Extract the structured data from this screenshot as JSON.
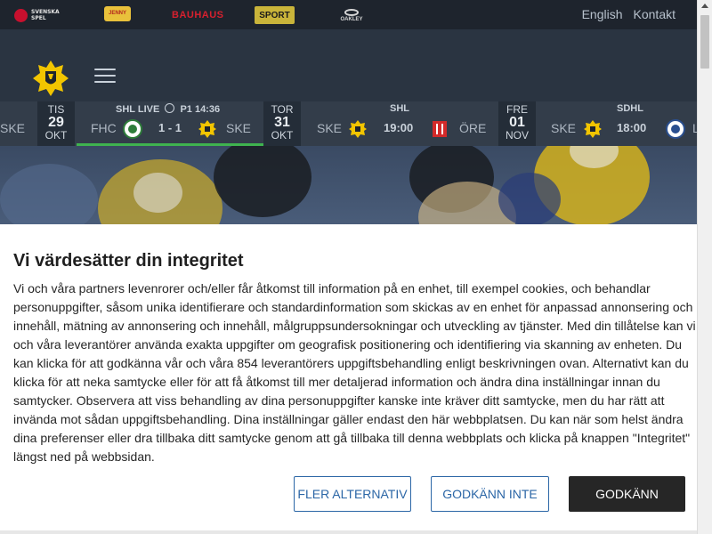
{
  "sponsors": {
    "svenska_spel": "SVENSKA SPEL",
    "jenny": "JENNY",
    "bauhaus": "BAUHAUS",
    "sport": "SPORT",
    "oakley": "OAKLEY"
  },
  "top_links": {
    "english": "English",
    "contact": "Kontakt"
  },
  "games": {
    "g0": {
      "team": "SKE"
    },
    "d1": {
      "dow": "TIS",
      "day": "29",
      "mon": "OKT"
    },
    "g1": {
      "head_league": "SHL LIVE",
      "head_period": "P1 14:36",
      "home": "FHC",
      "score": "1 - 1",
      "away": "SKE"
    },
    "d2": {
      "dow": "TOR",
      "day": "31",
      "mon": "OKT"
    },
    "g2": {
      "head": "SHL",
      "home": "SKE",
      "time": "19:00",
      "away": "ÖRE"
    },
    "d3": {
      "dow": "FRE",
      "day": "01",
      "mon": "NOV"
    },
    "g3": {
      "head": "SDHL",
      "home": "SKE",
      "time": "18:00",
      "away": "L"
    }
  },
  "consent": {
    "title": "Vi värdesätter din integritet",
    "body": "Vi och våra partners levenrorer och/eller får åtkomst till information på en enhet, till exempel cookies, och behandlar personuppgifter, såsom unika identifierare och standardinformation som skickas av en enhet för anpassad annonsering och innehåll, mätning av annonsering och innehåll, målgruppsundersokningar och utveckling av tjänster. Med din tillåtelse kan vi och våra leverantörer använda exakta uppgifter om geografisk positionering och identifiering via skanning av enheten. Du kan klicka för att godkänna vår och våra 854 leverantörers uppgiftsbehandling enligt beskrivningen ovan. Alternativt kan du klicka för att neka samtycke eller för att få åtkomst till mer detaljerad information och ändra dina inställningar innan du samtycker. Observera att viss behandling av dina personuppgifter kanske inte kräver ditt samtycke, men du har rätt att invända mot sådan uppgiftsbehandling. Dina inställningar gäller endast den här webbplatsen. Du kan när som helst ändra dina preferenser eller dra tillbaka ditt samtycke genom att gå tillbaka till denna webbplats och klicka på knappen \"Integritet\" längst ned på webbsidan.",
    "btn_more": "FLER ALTERNATIV",
    "btn_deny": "GODKÄNN INTE",
    "btn_accept": "GODKÄNN"
  },
  "colors": {
    "accent": "#2b66a6",
    "club_yellow": "#f2c500",
    "live_green": "#3fb34f",
    "dark_button": "#262626"
  }
}
